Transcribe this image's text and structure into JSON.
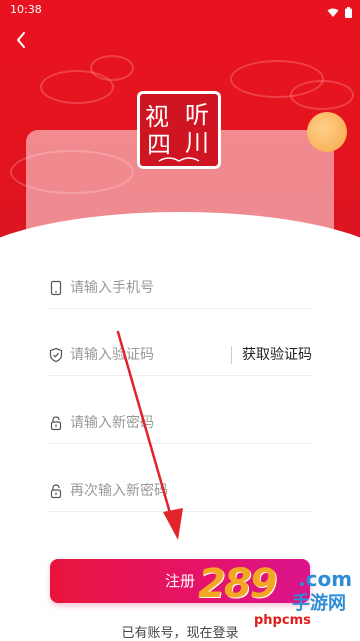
{
  "status_bar": {
    "time": "10:38"
  },
  "logo": {
    "chars": [
      "视",
      "听",
      "四",
      "川"
    ]
  },
  "form": {
    "phone_placeholder": "请输入手机号",
    "code_placeholder": "请输入验证码",
    "code_button": "获取验证码",
    "password_placeholder": "请输入新密码",
    "confirm_placeholder": "再次输入新密码"
  },
  "register_button": "注册",
  "login_link": "已有账号，现在登录",
  "watermark": {
    "number": "289",
    "domain": ".com",
    "cn": "手游网",
    "site": "phpcms"
  },
  "colors": {
    "brand_red": "#e3141f",
    "button_start": "#e8143c",
    "button_end": "#d9148c",
    "sun": "#f6a646"
  },
  "icons": [
    "back-arrow-icon",
    "phone-icon",
    "shield-check-icon",
    "lock-icon",
    "lock-icon",
    "wifi-icon",
    "battery-icon"
  ]
}
